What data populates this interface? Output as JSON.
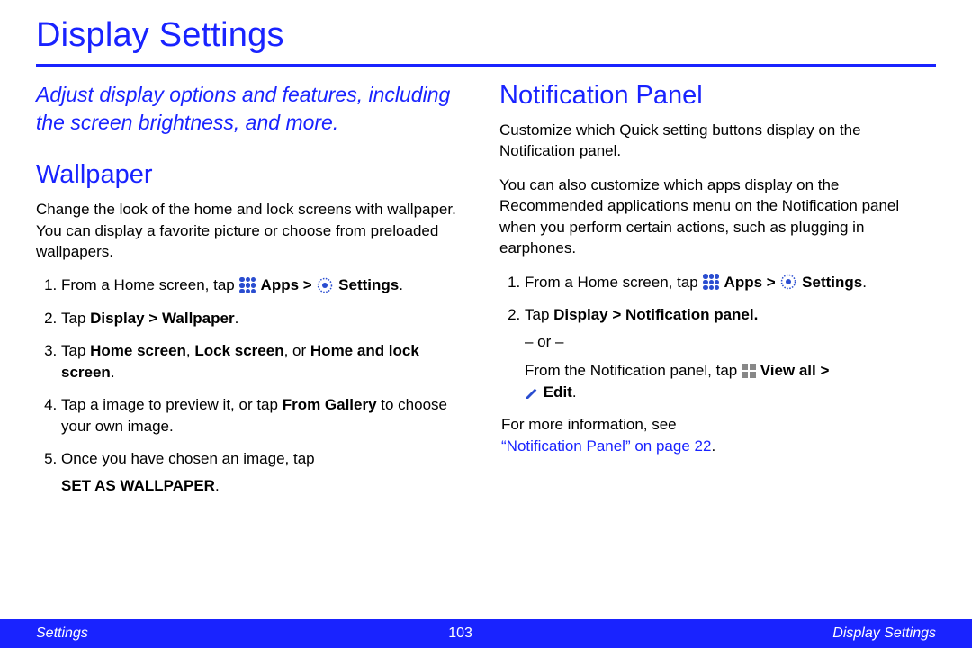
{
  "page_title": "Display Settings",
  "intro": "Adjust display options and features, including the screen brightness, and more.",
  "wallpaper": {
    "heading": "Wallpaper",
    "desc": "Change the look of the home and lock screens with wallpaper. You can display a favorite picture or choose from preloaded wallpapers.",
    "step1_a": "From a Home screen, tap ",
    "step1_apps": " Apps > ",
    "step1_settings": " Settings",
    "step1_dot": ".",
    "step2_a": "Tap ",
    "step2_b": "Display > Wallpaper",
    "step2_dot": ".",
    "step3_a": "Tap ",
    "step3_b": "Home screen",
    "step3_c": ", ",
    "step3_d": "Lock screen",
    "step3_e": ", or ",
    "step3_f": "Home and lock screen",
    "step3_dot": ".",
    "step4_a": "Tap a image to preview it, or tap ",
    "step4_b": "From Gallery",
    "step4_c": " to choose your own image.",
    "step5_a": " Once you have chosen an image, tap ",
    "step5_b": "SET AS WALLPAPER",
    "step5_dot": "."
  },
  "notif": {
    "heading": "Notification Panel",
    "desc1": "Customize which Quick setting buttons display on the Notification panel.",
    "desc2": "You can also customize which apps display on the Recommended applications menu on the Notification panel when you perform certain actions, such as plugging in earphones.",
    "step1_a": "From a Home screen, tap ",
    "step1_apps": " Apps > ",
    "step1_settings": " Settings",
    "step1_dot": ".",
    "step2_a": "Tap ",
    "step2_b": "Display > Notification panel.",
    "step2_or": "– or –",
    "step2_c": "From the Notification panel, tap ",
    "step2_d": " View all > ",
    "step2_e": " Edit",
    "step2_dot": ".",
    "after_a": "For more information, see ",
    "after_link": "“Notification Panel” on page 22",
    "after_dot": "."
  },
  "footer": {
    "left": "Settings",
    "center": "103",
    "right": "Display Settings"
  }
}
